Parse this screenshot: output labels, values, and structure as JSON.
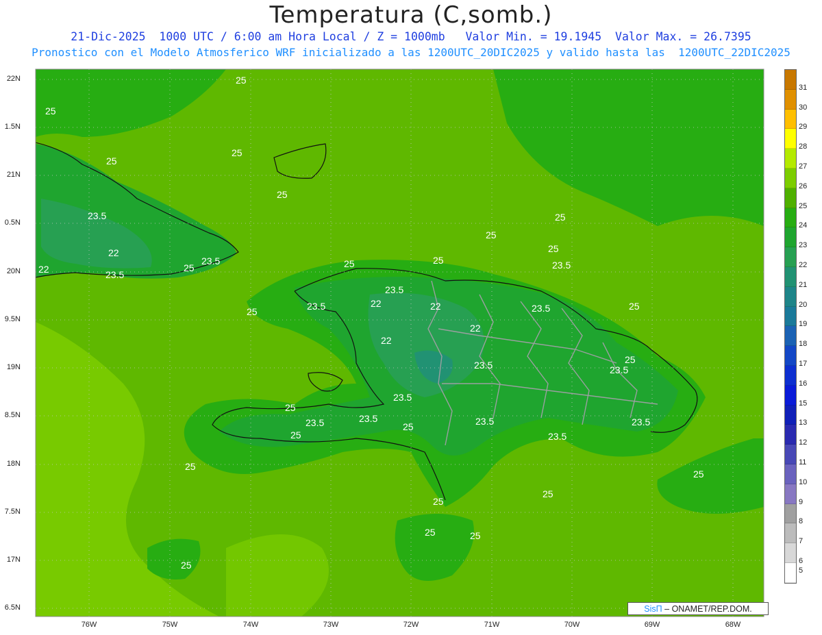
{
  "header": {
    "title": "Temperatura (C,somb.)",
    "line1": "21-Dic-2025  1000 UTC / 6:00 am Hora Local / Z = 1000mb   Valor Min. = 19.1945  Valor Max. = 26.7395",
    "line2": "Pronostico con el Modelo Atmosferico WRF inicializado a las 1200UTC_20DIC2025 y valido hasta las  1200UTC_22DIC2025"
  },
  "map": {
    "lat_labels": [
      "22N",
      "1.5N",
      "21N",
      "0.5N",
      "20N",
      "9.5N",
      "19N",
      "8.5N",
      "18N",
      "7.5N",
      "17N",
      "6.5N"
    ],
    "lon_labels": [
      "76W",
      "75W",
      "74W",
      "73W",
      "72W",
      "71W",
      "70W",
      "69W",
      "68W"
    ],
    "contour_labels": [
      {
        "text": "25",
        "where": "north-sea"
      },
      {
        "text": "25",
        "where": "nw"
      },
      {
        "text": "25",
        "where": "cuba-east"
      },
      {
        "text": "23.5",
        "where": "cuba"
      },
      {
        "text": "22",
        "where": "cuba"
      },
      {
        "text": "25",
        "where": "hispaniola"
      },
      {
        "text": "23.5",
        "where": "hispaniola"
      },
      {
        "text": "22",
        "where": "hispaniola"
      },
      {
        "text": "25",
        "where": "south-sea"
      }
    ],
    "colors": {
      "sea_25_26": "#5fb800",
      "land_24_25": "#1fac26",
      "land_23_24": "#2aa63a",
      "land_22_23": "#2c9f5a",
      "land_21_22": "#24917a",
      "warm_26_27": "#8fd400"
    }
  },
  "colorbar": {
    "labels": [
      "31",
      "30",
      "29",
      "28",
      "27",
      "26",
      "25",
      "24",
      "23",
      "22",
      "21",
      "20",
      "19",
      "18",
      "17",
      "16",
      "15",
      "13",
      "12",
      "11",
      "10",
      "9",
      "8",
      "7",
      "6",
      "5"
    ],
    "colors": [
      "#c87800",
      "#e09000",
      "#ffbf00",
      "#ffff00",
      "#b4ea00",
      "#7ccd00",
      "#4fb000",
      "#27ad12",
      "#1fa52f",
      "#27a052",
      "#219273",
      "#1e8589",
      "#1a7a9a",
      "#1b62b4",
      "#1347c6",
      "#0d2fd0",
      "#0a1bd8",
      "#1020b8",
      "#2a2ab0",
      "#4848b6",
      "#6a62be",
      "#8878c2",
      "#a0a0a0",
      "#bcbcbc",
      "#d8d8d8",
      "#ffffff"
    ]
  },
  "credit": {
    "sis": "SisΠ",
    "org": "– ONAMET/REP.DOM."
  }
}
